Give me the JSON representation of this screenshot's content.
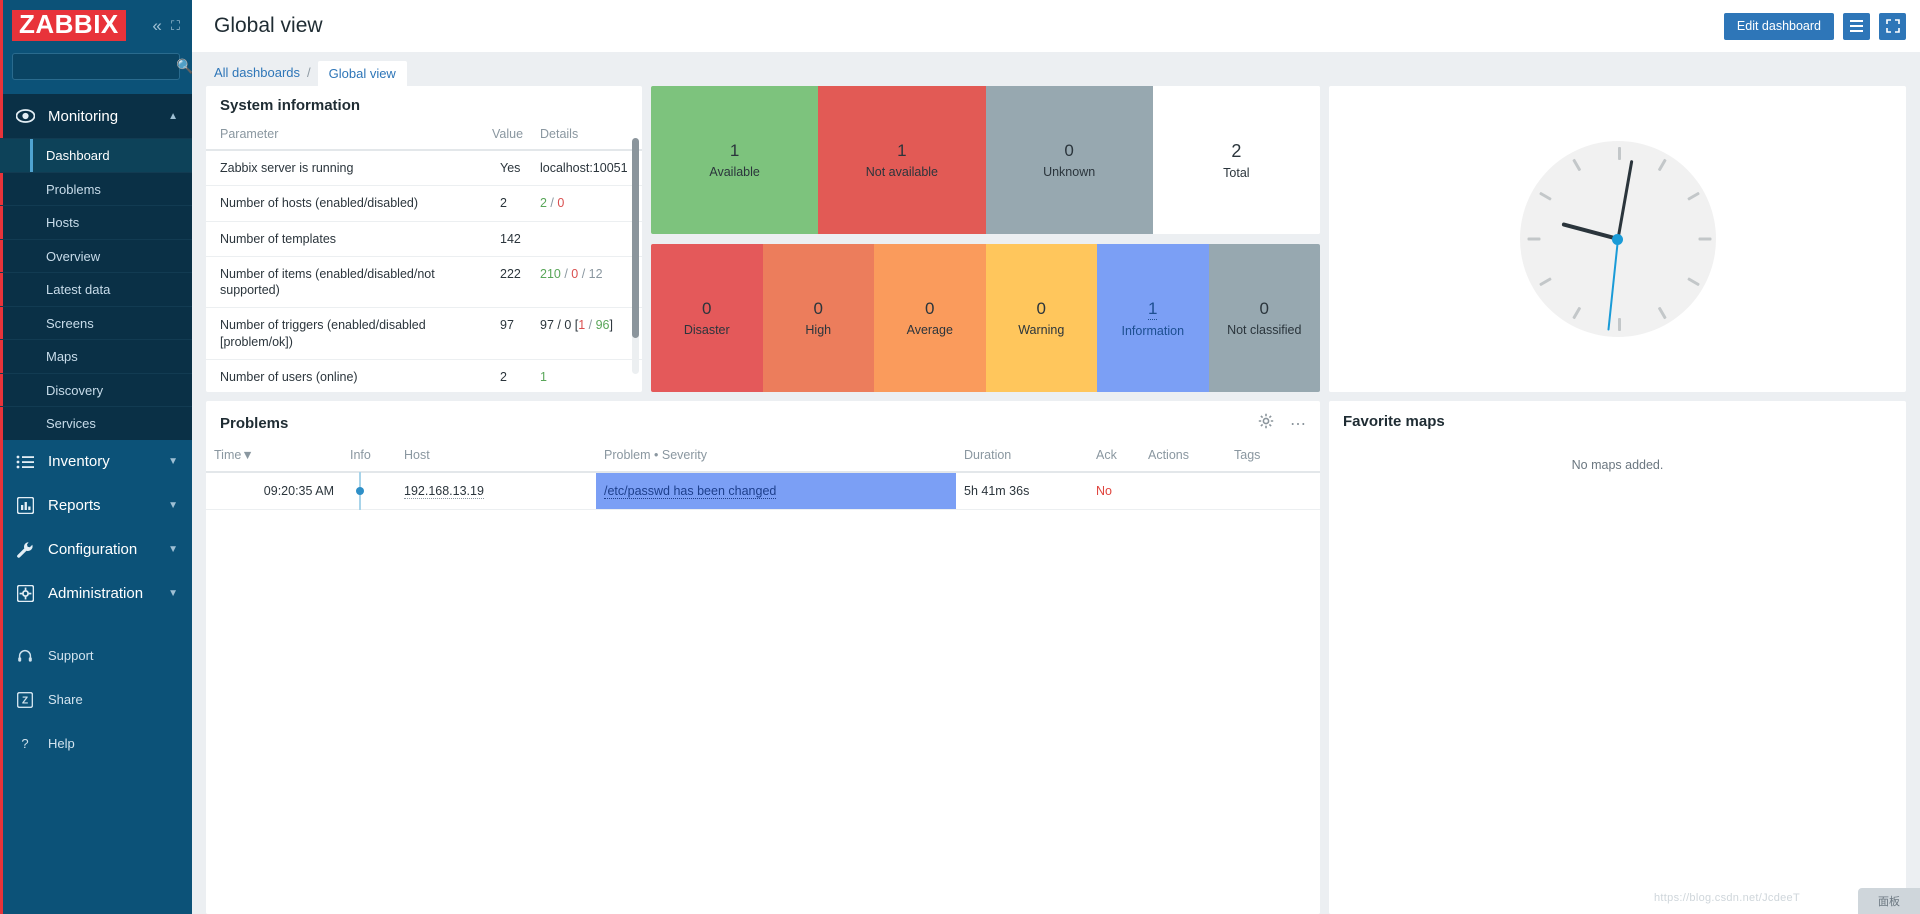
{
  "brand": {
    "logo": "ZABBIX"
  },
  "search": {
    "value": "",
    "placeholder": ""
  },
  "sidebar": {
    "groups": [
      {
        "label": "Monitoring",
        "icon": "eye-icon",
        "items": [
          {
            "label": "Dashboard",
            "selected": true
          },
          {
            "label": "Problems",
            "selected": false
          },
          {
            "label": "Hosts",
            "selected": false
          },
          {
            "label": "Overview",
            "selected": false
          },
          {
            "label": "Latest data",
            "selected": false
          },
          {
            "label": "Screens",
            "selected": false
          },
          {
            "label": "Maps",
            "selected": false
          },
          {
            "label": "Discovery",
            "selected": false
          },
          {
            "label": "Services",
            "selected": false
          }
        ]
      }
    ],
    "sections": [
      {
        "label": "Inventory",
        "icon": "list-icon"
      },
      {
        "label": "Reports",
        "icon": "bar-chart-icon"
      },
      {
        "label": "Configuration",
        "icon": "wrench-icon"
      },
      {
        "label": "Administration",
        "icon": "gear-icon"
      }
    ],
    "bottom": [
      {
        "label": "Support",
        "icon": "headset-icon"
      },
      {
        "label": "Share",
        "icon": "zabbix-z-icon"
      },
      {
        "label": "Help",
        "icon": "question-icon"
      }
    ]
  },
  "header": {
    "title": "Global view",
    "edit_button": "Edit dashboard"
  },
  "breadcrumb": {
    "all_dashboards": "All dashboards",
    "separator": "/",
    "current": "Global view"
  },
  "system_information": {
    "title": "System information",
    "columns": [
      "Parameter",
      "Value",
      "Details"
    ],
    "rows": [
      {
        "parameter": "Zabbix server is running",
        "value": "Yes",
        "value_color": "green",
        "details": "localhost:10051",
        "details_parts": []
      },
      {
        "parameter": "Number of hosts (enabled/disabled)",
        "value": "2",
        "value_color": "dark",
        "details": "",
        "details_parts": [
          {
            "text": "2",
            "color": "green"
          },
          {
            "text": " / ",
            "color": "grey"
          },
          {
            "text": "0",
            "color": "red"
          }
        ]
      },
      {
        "parameter": "Number of templates",
        "value": "142",
        "value_color": "dark",
        "details": "",
        "details_parts": []
      },
      {
        "parameter": "Number of items (enabled/disabled/not supported)",
        "value": "222",
        "value_color": "dark",
        "details": "",
        "details_parts": [
          {
            "text": "210",
            "color": "green"
          },
          {
            "text": " / ",
            "color": "grey"
          },
          {
            "text": "0",
            "color": "red"
          },
          {
            "text": " / ",
            "color": "grey"
          },
          {
            "text": "12",
            "color": "grey"
          }
        ]
      },
      {
        "parameter": "Number of triggers (enabled/disabled [problem/ok])",
        "value": "97",
        "value_color": "dark",
        "details": "",
        "details_parts": [
          {
            "text": "97 / 0 [",
            "color": "dark"
          },
          {
            "text": "1",
            "color": "red"
          },
          {
            "text": " / ",
            "color": "grey"
          },
          {
            "text": "96",
            "color": "green"
          },
          {
            "text": "]",
            "color": "dark"
          }
        ]
      },
      {
        "parameter": "Number of users (online)",
        "value": "2",
        "value_color": "dark",
        "details": "",
        "details_parts": [
          {
            "text": "1",
            "color": "green"
          }
        ]
      }
    ]
  },
  "host_availability": {
    "tiles": [
      {
        "count": "1",
        "label": "Available",
        "color": "#7dc37d"
      },
      {
        "count": "1",
        "label": "Not available",
        "color": "#e25a55"
      },
      {
        "count": "0",
        "label": "Unknown",
        "color": "#97a8b0"
      },
      {
        "count": "2",
        "label": "Total",
        "color": "#ffffff"
      }
    ]
  },
  "problems_by_severity": {
    "tiles": [
      {
        "count": "0",
        "label": "Disaster",
        "color": "#e4595a",
        "is_link": false
      },
      {
        "count": "0",
        "label": "High",
        "color": "#ec7d5c",
        "is_link": false
      },
      {
        "count": "0",
        "label": "Average",
        "color": "#fa9b5c",
        "is_link": false
      },
      {
        "count": "0",
        "label": "Warning",
        "color": "#ffc65c",
        "is_link": false
      },
      {
        "count": "1",
        "label": "Information",
        "color": "#7b9ff5",
        "is_link": true
      },
      {
        "count": "0",
        "label": "Not classified",
        "color": "#97a8b0",
        "is_link": false
      }
    ]
  },
  "clock": {
    "hour_deg": 285,
    "minute_deg": 10,
    "second_deg": 186
  },
  "problems": {
    "title": "Problems",
    "columns": [
      "Time",
      "Info",
      "Host",
      "Problem • Severity",
      "Duration",
      "Ack",
      "Actions",
      "Tags"
    ],
    "sort_indicator": "▼",
    "rows": [
      {
        "time": "09:20:35 AM",
        "info": "",
        "host": "192.168.13.19",
        "problem": "/etc/passwd has been changed",
        "duration": "5h 41m 36s",
        "ack": "No",
        "actions": "",
        "tags": ""
      }
    ]
  },
  "favorite_maps": {
    "title": "Favorite maps",
    "empty_text": "No maps added."
  },
  "watermark": {
    "text": "https://blog.csdn.net/JcdeeT",
    "badge": "面板"
  }
}
